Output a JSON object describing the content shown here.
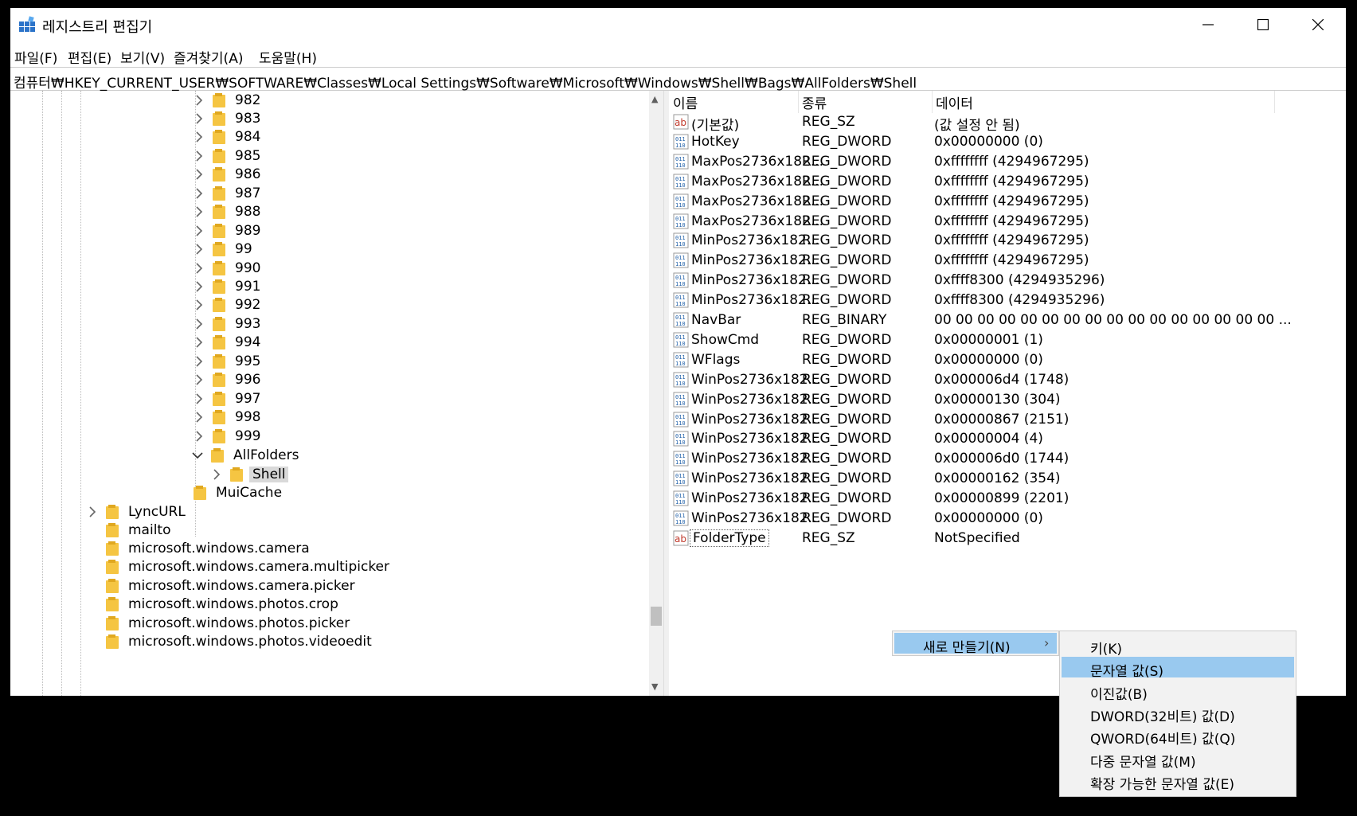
{
  "window": {
    "title": "레지스트리 편집기"
  },
  "menu": [
    "파일(F)",
    "편집(E)",
    "보기(V)",
    "즐겨찾기(A)",
    "도움말(H)"
  ],
  "address": "컴퓨터₩HKEY_CURRENT_USER₩SOFTWARE₩Classes₩Local Settings₩Software₩Microsoft₩Windows₩Shell₩Bags₩AllFolders₩Shell",
  "tree": {
    "numbered": [
      "982",
      "983",
      "984",
      "985",
      "986",
      "987",
      "988",
      "989",
      "99",
      "990",
      "991",
      "992",
      "993",
      "994",
      "995",
      "996",
      "997",
      "998",
      "999"
    ],
    "allfolders": "AllFolders",
    "shell": "Shell",
    "muicache": "MuiCache",
    "lync": "LyncURL",
    "others": [
      "mailto",
      "microsoft.windows.camera",
      "microsoft.windows.camera.multipicker",
      "microsoft.windows.camera.picker",
      "microsoft.windows.photos.crop",
      "microsoft.windows.photos.picker",
      "microsoft.windows.photos.videoedit"
    ]
  },
  "list": {
    "headers": {
      "name": "이름",
      "type": "종류",
      "data": "데이터"
    },
    "rows": [
      {
        "icon": "string",
        "name": "(기본값)",
        "type": "REG_SZ",
        "data": "(값 설정 안 됨)"
      },
      {
        "icon": "binary",
        "name": "HotKey",
        "type": "REG_DWORD",
        "data": "0x00000000 (0)"
      },
      {
        "icon": "binary",
        "name": "MaxPos2736x182...",
        "type": "REG_DWORD",
        "data": "0xffffffff (4294967295)"
      },
      {
        "icon": "binary",
        "name": "MaxPos2736x182...",
        "type": "REG_DWORD",
        "data": "0xffffffff (4294967295)"
      },
      {
        "icon": "binary",
        "name": "MaxPos2736x182...",
        "type": "REG_DWORD",
        "data": "0xffffffff (4294967295)"
      },
      {
        "icon": "binary",
        "name": "MaxPos2736x182...",
        "type": "REG_DWORD",
        "data": "0xffffffff (4294967295)"
      },
      {
        "icon": "binary",
        "name": "MinPos2736x182...",
        "type": "REG_DWORD",
        "data": "0xffffffff (4294967295)"
      },
      {
        "icon": "binary",
        "name": "MinPos2736x182...",
        "type": "REG_DWORD",
        "data": "0xffffffff (4294967295)"
      },
      {
        "icon": "binary",
        "name": "MinPos2736x182...",
        "type": "REG_DWORD",
        "data": "0xffff8300 (4294935296)"
      },
      {
        "icon": "binary",
        "name": "MinPos2736x182...",
        "type": "REG_DWORD",
        "data": "0xffff8300 (4294935296)"
      },
      {
        "icon": "binary",
        "name": "NavBar",
        "type": "REG_BINARY",
        "data": "00 00 00 00 00 00 00 00 00 00 00 00 00 00 00 00 ..."
      },
      {
        "icon": "binary",
        "name": "ShowCmd",
        "type": "REG_DWORD",
        "data": "0x00000001 (1)"
      },
      {
        "icon": "binary",
        "name": "WFlags",
        "type": "REG_DWORD",
        "data": "0x00000000 (0)"
      },
      {
        "icon": "binary",
        "name": "WinPos2736x182...",
        "type": "REG_DWORD",
        "data": "0x000006d4 (1748)"
      },
      {
        "icon": "binary",
        "name": "WinPos2736x182...",
        "type": "REG_DWORD",
        "data": "0x00000130 (304)"
      },
      {
        "icon": "binary",
        "name": "WinPos2736x182...",
        "type": "REG_DWORD",
        "data": "0x00000867 (2151)"
      },
      {
        "icon": "binary",
        "name": "WinPos2736x182...",
        "type": "REG_DWORD",
        "data": "0x00000004 (4)"
      },
      {
        "icon": "binary",
        "name": "WinPos2736x182...",
        "type": "REG_DWORD",
        "data": "0x000006d0 (1744)"
      },
      {
        "icon": "binary",
        "name": "WinPos2736x182...",
        "type": "REG_DWORD",
        "data": "0x00000162 (354)"
      },
      {
        "icon": "binary",
        "name": "WinPos2736x182...",
        "type": "REG_DWORD",
        "data": "0x00000899 (2201)"
      },
      {
        "icon": "binary",
        "name": "WinPos2736x182...",
        "type": "REG_DWORD",
        "data": "0x00000000 (0)"
      },
      {
        "icon": "string",
        "name": "FolderType",
        "type": "REG_SZ",
        "data": "NotSpecified"
      }
    ]
  },
  "context_menu": {
    "parent": "새로 만들기(N)",
    "items": [
      "키(K)",
      "문자열 값(S)",
      "이진값(B)",
      "DWORD(32비트) 값(D)",
      "QWORD(64비트) 값(Q)",
      "다중 문자열 값(M)",
      "확장 가능한 문자열 값(E)"
    ],
    "highlighted_index": 1
  }
}
